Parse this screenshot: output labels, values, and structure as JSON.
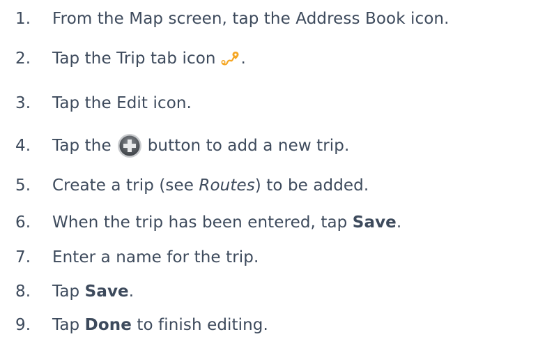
{
  "steps": [
    {
      "num": "1.",
      "text": "From the Map screen, tap the Address Book icon."
    },
    {
      "num": "2.",
      "pre": "Tap the Trip tab icon",
      "post": ".",
      "icon": "trip-route-icon"
    },
    {
      "num": "3.",
      "text": "Tap the Edit icon."
    },
    {
      "num": "4.",
      "pre": "Tap the",
      "post": "button to add a new trip.",
      "icon": "plus-button-icon"
    },
    {
      "num": "5.",
      "pre": "Create a trip (see ",
      "italic": "Routes",
      "post": ") to be added."
    },
    {
      "num": "6.",
      "pre": "When the trip has been entered, tap ",
      "bold": "Save",
      "post": "."
    },
    {
      "num": "7.",
      "text": "Enter a name for the trip."
    },
    {
      "num": "8.",
      "pre": "Tap ",
      "bold": "Save",
      "post": "."
    },
    {
      "num": "9.",
      "pre": "Tap ",
      "bold": "Done",
      "post": " to finish editing."
    }
  ],
  "colors": {
    "text": "#3d4a5c",
    "trip_icon": "#f5a623",
    "plus_button": "#5a5e63"
  }
}
